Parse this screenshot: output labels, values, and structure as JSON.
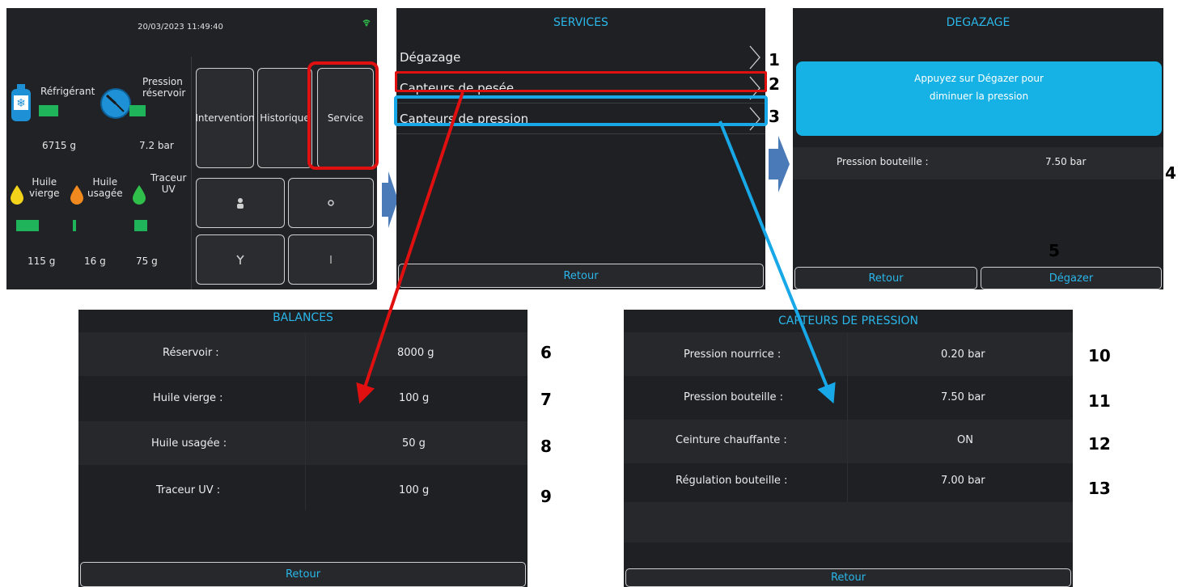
{
  "home": {
    "datetime": "20/03/2023 11:49:40",
    "refrigerant_label": "Réfrigérant",
    "refrigerant_value": "6715 g",
    "pressure_label_1": "Pression",
    "pressure_label_2": "réservoir",
    "pressure_value": "7.2 bar",
    "oil_new_label_1": "Huile",
    "oil_new_label_2": "vierge",
    "oil_new_value": "115 g",
    "oil_used_label_1": "Huile",
    "oil_used_label_2": "usagée",
    "oil_used_value": "16 g",
    "uv_label_1": "Traceur",
    "uv_label_2": "UV",
    "uv_value": "75 g",
    "btn_intervention": "Intervention",
    "btn_historique": "Historique",
    "btn_service": "Service",
    "colors": {
      "bar": "#1fb35a",
      "refrigerant": "#1e90d6",
      "oil_new": "#f2d21a",
      "oil_used": "#f08a1e",
      "uv": "#2fbf4a"
    }
  },
  "services": {
    "title": "SERVICES",
    "items": [
      {
        "label": "Dégazage"
      },
      {
        "label": "Capteurs de pesée"
      },
      {
        "label": "Capteurs de pression"
      }
    ],
    "retour": "Retour"
  },
  "degazage": {
    "title": "DEGAZAGE",
    "info_line_1": "Appuyez sur Dégazer pour",
    "info_line_2": "diminuer la pression",
    "pressure_label": "Pression bouteille :",
    "pressure_value": "7.50 bar",
    "retour": "Retour",
    "degazer": "Dégazer"
  },
  "balances": {
    "title": "BALANCES",
    "rows": [
      {
        "label": "Réservoir :",
        "value": "8000 g"
      },
      {
        "label": "Huile vierge :",
        "value": "100 g"
      },
      {
        "label": "Huile usagée :",
        "value": "50 g"
      },
      {
        "label": "Traceur UV :",
        "value": "100 g"
      }
    ],
    "retour": "Retour"
  },
  "capteurs": {
    "title": "CAPTEURS DE PRESSION",
    "rows": [
      {
        "label": "Pression nourrice :",
        "value": "0.20 bar"
      },
      {
        "label": "Pression bouteille :",
        "value": "7.50 bar"
      },
      {
        "label": "Ceinture chauffante :",
        "value": "ON"
      },
      {
        "label": "Régulation bouteille :",
        "value": "7.00 bar"
      }
    ],
    "retour": "Retour"
  },
  "annotations": [
    "1",
    "2",
    "3",
    "4",
    "5",
    "6",
    "7",
    "8",
    "9",
    "10",
    "11",
    "12",
    "13"
  ]
}
